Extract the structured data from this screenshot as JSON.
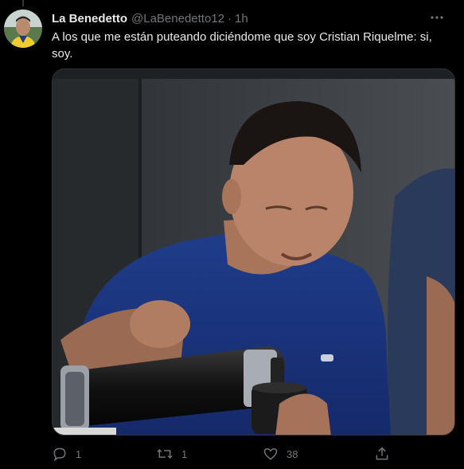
{
  "tweet": {
    "author_name": "La Benedetto",
    "author_handle": "@LaBenedetto12",
    "separator": "·",
    "time": "1h",
    "text": "A los que me están puteando diciéndome que soy Cristian Riquelme: si, soy.",
    "media_icon": "photo-of-man-pouring-from-thermos-into-mate"
  },
  "actions": {
    "reply_count": "1",
    "retweet_count": "1",
    "like_count": "38"
  },
  "colors": {
    "background": "#000000",
    "text_primary": "#e7e9ea",
    "text_secondary": "#71767b"
  }
}
